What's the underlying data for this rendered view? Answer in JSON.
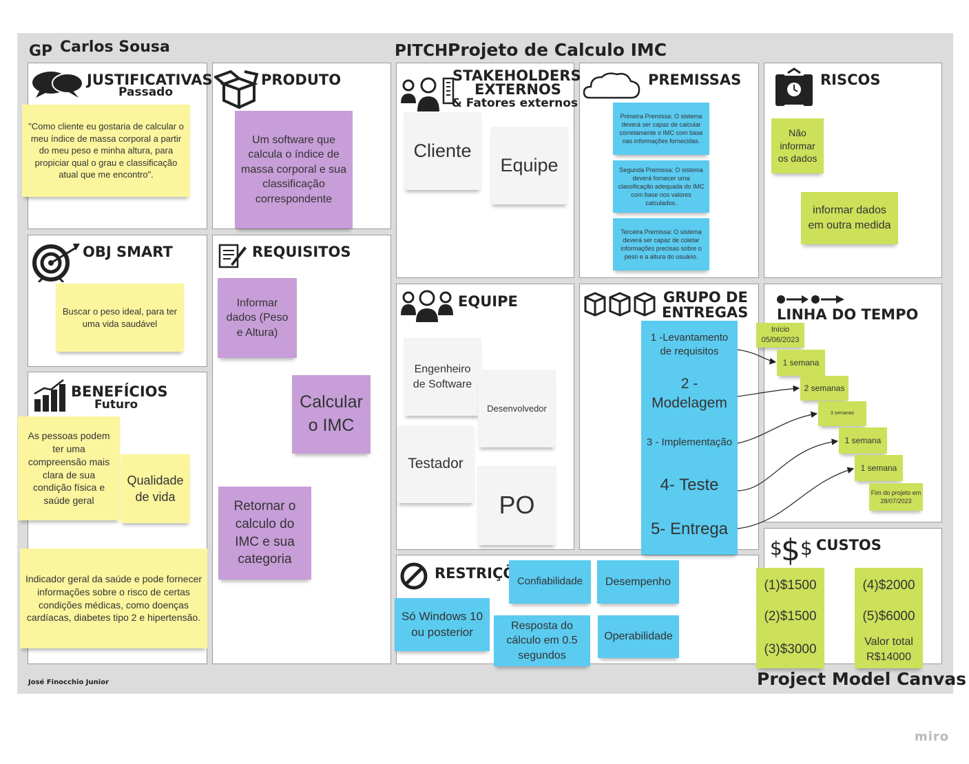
{
  "header": {
    "gp_label": "GP",
    "manager": "Carlos Sousa",
    "pitch_label": "PITCH",
    "project_title": "Projeto de Calculo IMC"
  },
  "panels": {
    "justificativas": {
      "title": "JUSTIFICATIVAS",
      "subtitle": "Passado"
    },
    "produto": {
      "title": "PRODUTO"
    },
    "stakeholders": {
      "title_line1": "STAKEHOLDERS",
      "title_line2": "EXTERNOS",
      "subtitle": "& Fatores externos"
    },
    "premissas": {
      "title": "PREMISSAS"
    },
    "riscos": {
      "title": "RISCOS"
    },
    "obj_smart": {
      "title": "OBJ SMART"
    },
    "requisitos": {
      "title": "REQUISITOS"
    },
    "equipe": {
      "title": "EQUIPE"
    },
    "grupo_entregas": {
      "title_line1": "GRUPO DE",
      "title_line2": "ENTREGAS"
    },
    "linha_tempo": {
      "title": "LINHA DO TEMPO"
    },
    "beneficios": {
      "title": "BENEFÍCIOS",
      "subtitle": "Futuro"
    },
    "restricoes": {
      "title": "RESTRIÇÕ"
    },
    "custos": {
      "title": "CUSTOS"
    }
  },
  "notes": {
    "justificativa": "\"Como cliente eu gostaria de calcular o meu índice de massa corporal a partir do meu peso e minha altura, para propiciar qual o grau e classificação atual que me encontro\".",
    "produto": "Um software que calcula o índice de massa corporal e sua classificação correspondente",
    "stakeholders": [
      "Cliente",
      "Equipe"
    ],
    "premissas": [
      "Primeira Premissa: O sistema deverá ser capaz de calcular corretamente o IMC com base nas informações fornecidas.",
      "Segunda Premissa:  O sistema deverá fornecer uma classificação adequada do IMC com base nos valores calculados.",
      "Terceira Premissa:  O sistema deverá ser capaz de coletar informações precisas sobre o peso e a altura do usuário."
    ],
    "riscos": [
      "Não informar os dados",
      "informar dados em outra medida"
    ],
    "obj_smart": "Buscar o peso ideal, para ter uma vida saudável",
    "requisitos": [
      "Informar dados (Peso e Altura)",
      "Calcular o IMC",
      "Retornar o calculo do IMC e sua categoria"
    ],
    "equipe": [
      "Engenheiro de Software",
      "Desenvolvedor",
      "Testador",
      "PO"
    ],
    "entregas": [
      "1 -Levantamento de requisitos",
      "2 - Modelagem",
      "3 - Implementação",
      "4- Teste",
      "5- Entrega"
    ],
    "timeline": {
      "start": "Início 05/06/2023",
      "steps": [
        "1 semana",
        "2 semanas",
        "3 semanas",
        "1 semana",
        "1 semana"
      ],
      "end": "Fim do projeto em 28/07/2023"
    },
    "beneficios": [
      "As pessoas podem ter uma compreensão mais clara de sua condição física e saúde geral",
      "Qualidade de vida",
      "Indicador geral da saúde e pode fornecer informações sobre o risco de certas condições médicas, como doenças cardíacas, diabetes tipo 2 e hipertensão."
    ],
    "restricoes": [
      "Confiabilidade",
      "Desempenho",
      "Só Windows 10 ou posterior",
      "Resposta do cálculo em 0.5 segundos",
      "Operabilidade"
    ],
    "custos": [
      "(1)$1500",
      "(4)$2000",
      "(2)$1500",
      "(5)$6000",
      "(3)$3000",
      "Valor total R$14000"
    ]
  },
  "footer": {
    "author": "José Finocchio Junior",
    "canvas_name": "Project Model Canvas",
    "watermark": "miro"
  },
  "colors": {
    "yellow": "#fbf59e",
    "purple": "#c79ed8",
    "blue": "#5bcbf0",
    "green": "#cce05a",
    "white_note": "#f4f4f4",
    "board": "#dcdcdc"
  }
}
